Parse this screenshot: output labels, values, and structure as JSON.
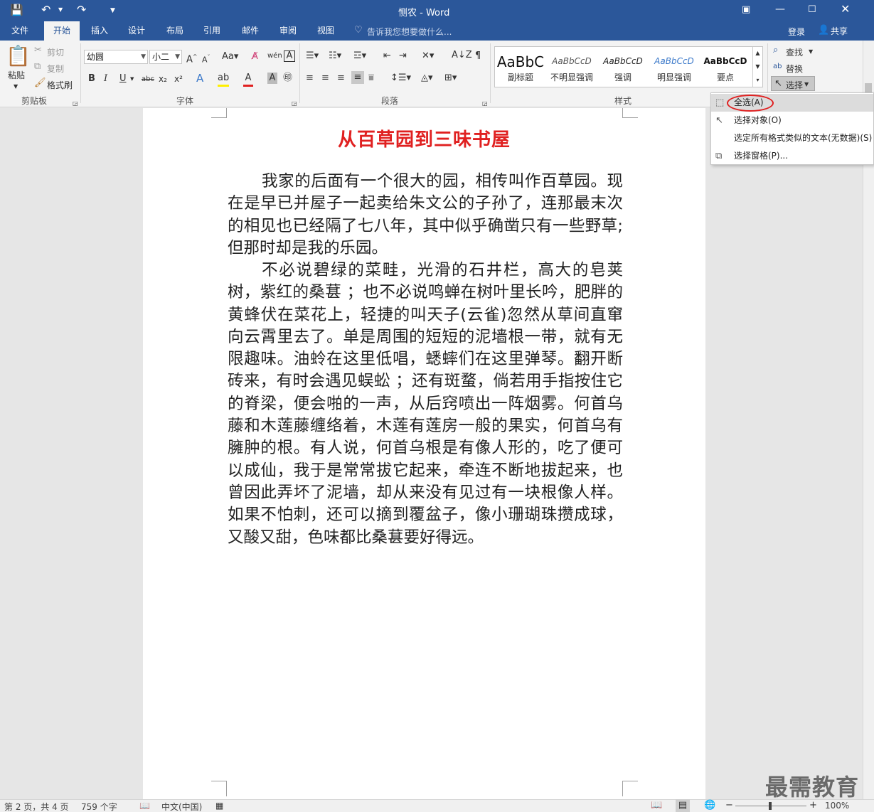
{
  "window": {
    "title": "恻农 - Word",
    "qat_more": "▼"
  },
  "tabs": [
    "文件",
    "开始",
    "插入",
    "设计",
    "布局",
    "引用",
    "邮件",
    "审阅",
    "视图"
  ],
  "tell_me": "告诉我您想要做什么...",
  "account": {
    "login": "登录",
    "share": "共享"
  },
  "clipboard": {
    "paste": "粘贴",
    "cut": "剪切",
    "copy": "复制",
    "format_painter": "格式刷",
    "group": "剪贴板"
  },
  "font": {
    "name": "幼圆",
    "size": "小二",
    "group": "字体",
    "bold": "B",
    "italic": "I",
    "underline": "U",
    "strike": "abc"
  },
  "paragraph": {
    "group": "段落"
  },
  "styles": {
    "group": "样式",
    "items": [
      {
        "sample": "AaBbC",
        "name": "副标题"
      },
      {
        "sample": "AaBbCcD",
        "name": "不明显强调"
      },
      {
        "sample": "AaBbCcD",
        "name": "强调"
      },
      {
        "sample": "AaBbCcD",
        "name": "明显强调"
      },
      {
        "sample": "AaBbCcD",
        "name": "要点"
      }
    ]
  },
  "editing": {
    "find": "查找",
    "replace": "替换",
    "select": "选择"
  },
  "select_menu": {
    "items": [
      "全选(A)",
      "选择对象(O)",
      "选定所有格式类似的文本(无数据)(S)",
      "选择窗格(P)..."
    ]
  },
  "document": {
    "title": "从百草园到三味书屋",
    "paragraphs": [
      "我家的后面有一个很大的园，相传叫作百草园。现在是早已并屋子一起卖给朱文公的子孙了，连那最末次的相见也已经隔了七八年，其中似乎确凿只有一些野草;但那时却是我的乐园。",
      "不必说碧绿的菜畦，光滑的石井栏，高大的皂荚树，紫红的桑葚 ；也不必说鸣蝉在树叶里长吟，肥胖的黄蜂伏在菜花上，轻捷的叫天子(云雀)忽然从草间直窜向云霄里去了。单是周围的短短的泥墙根一带，就有无限趣味。油蛉在这里低唱，蟋蟀们在这里弹琴。翻开断砖来，有时会遇见蜈蚣 ；还有斑蝥，倘若用手指按住它的脊梁，便会啪的一声，从后窍喷出一阵烟雾。何首乌藤和木莲藤缠络着，木莲有莲房一般的果实，何首乌有臃肿的根。有人说，何首乌根是有像人形的，吃了便可以成仙，我于是常常拔它起来，牵连不断地拔起来，也曾因此弄坏了泥墙，却从来没有见过有一块根像人样。如果不怕刺，还可以摘到覆盆子，像小珊瑚珠攒成球，又酸又甜，色味都比桑葚要好得远。"
    ]
  },
  "status": {
    "page": "第 2 页，共 4 页",
    "words": "759 个字",
    "lang": "中文(中国)",
    "zoom": "100%"
  },
  "watermark": "最需教育"
}
